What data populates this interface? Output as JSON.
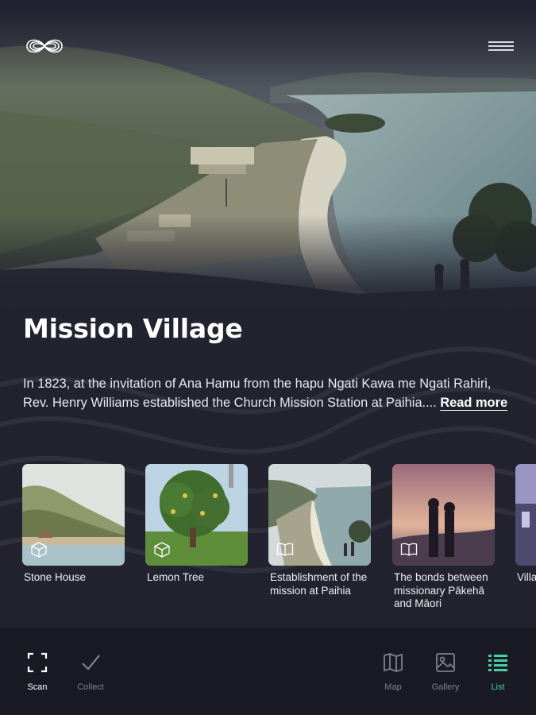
{
  "header": {
    "logo_icon": "infinity-logo-icon",
    "menu_icon": "hamburger-menu-icon"
  },
  "location": {
    "title": "Mission Village",
    "description": "In 1823, at the invitation of Ana Hamu from the hapu Ngati Kawa me Ngati Rahiri, Rev. Henry Williams established the Church Mission Station at Paihia....",
    "read_more": "Read more"
  },
  "stories": [
    {
      "label": "Stone House",
      "type_icon": "cube-3d-icon"
    },
    {
      "label": "Lemon Tree",
      "type_icon": "cube-3d-icon"
    },
    {
      "label": "Establishment of the mission at Paihia",
      "type_icon": "open-book-icon"
    },
    {
      "label": "The bonds between missionary Pākehā and Māori",
      "type_icon": "open-book-icon"
    },
    {
      "label": "Villa",
      "type_icon": "open-book-icon"
    }
  ],
  "tabbar": {
    "scan": "Scan",
    "collect": "Collect",
    "map": "Map",
    "gallery": "Gallery",
    "list": "List"
  },
  "colors": {
    "background": "#22232f",
    "tabbar": "#1a1a24",
    "accent_green": "#41d1a5",
    "inactive": "#7f808c"
  }
}
